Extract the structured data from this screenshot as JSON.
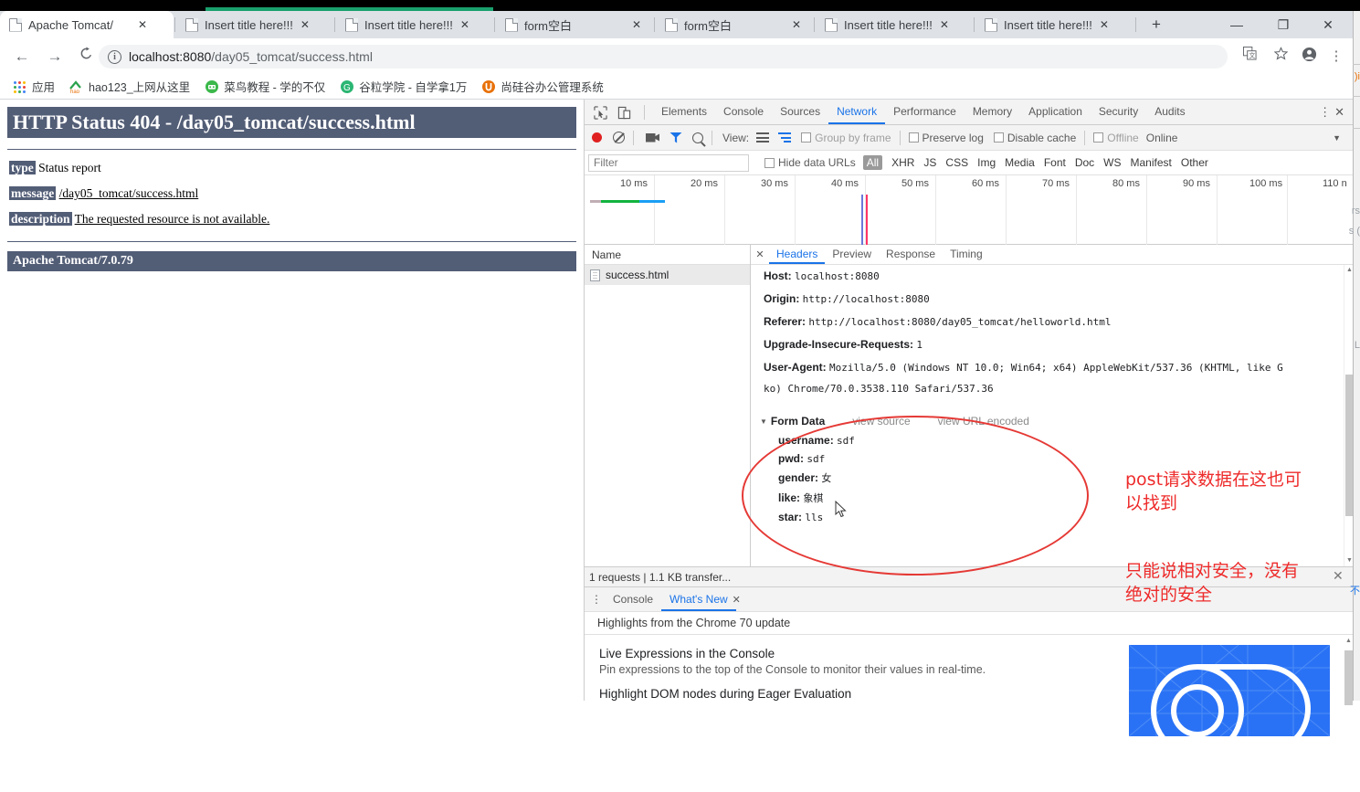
{
  "browser": {
    "tabs": [
      {
        "title": "Apache Tomcat/",
        "active": true
      },
      {
        "title": "Insert title here!!!",
        "active": false
      },
      {
        "title": "Insert title here!!!",
        "active": false
      },
      {
        "title": "form空白",
        "active": false
      },
      {
        "title": "form空白",
        "active": false
      },
      {
        "title": "Insert title here!!!",
        "active": false
      },
      {
        "title": "Insert title here!!!",
        "active": false
      }
    ],
    "new_tab_label": "+",
    "window_minimize": "—",
    "window_restore": "❐",
    "window_close": "✕",
    "nav": {
      "back": "←",
      "forward": "→",
      "reload": "C"
    },
    "url_host": "localhost:8080",
    "url_path": "/day05_tomcat/success.html",
    "omnibox_icons": [
      "translate-icon",
      "star-icon",
      "profile-icon",
      "menu-icon"
    ],
    "bookmarks": [
      {
        "label": "应用",
        "icon": "apps-grid-icon"
      },
      {
        "label": "hao123_上网从这里",
        "icon": "hao123-icon"
      },
      {
        "label": "菜鸟教程 - 学的不仅",
        "icon": "runoob-icon"
      },
      {
        "label": "谷粒学院 - 自学拿1万",
        "icon": "guli-icon"
      },
      {
        "label": "尚硅谷办公管理系统",
        "icon": "atguigu-icon"
      }
    ]
  },
  "tomcat": {
    "title": "HTTP Status 404 - /day05_tomcat/success.html",
    "rows": [
      {
        "key": "type",
        "value": "Status report",
        "link": false
      },
      {
        "key": "message",
        "value": "/day05_tomcat/success.html",
        "link": true
      },
      {
        "key": "description",
        "value": "The requested resource is not available.",
        "link": true
      }
    ],
    "footer": "Apache Tomcat/7.0.79"
  },
  "devtools": {
    "panels": [
      "Elements",
      "Console",
      "Sources",
      "Network",
      "Performance",
      "Memory",
      "Application",
      "Security",
      "Audits"
    ],
    "active_panel": "Network",
    "more_label": "⋮",
    "close_label": "✕",
    "toolbar": {
      "view_label": "View:",
      "group_by_frame": "Group by frame",
      "preserve_log": "Preserve log",
      "disable_cache": "Disable cache",
      "offline": "Offline",
      "online": "Online",
      "caret": "▼"
    },
    "filterbar": {
      "placeholder": "Filter",
      "hide_data_urls": "Hide data URLs",
      "types": [
        "All",
        "XHR",
        "JS",
        "CSS",
        "Img",
        "Media",
        "Font",
        "Doc",
        "WS",
        "Manifest",
        "Other"
      ],
      "active_type": "All"
    },
    "overview_ticks": [
      "10 ms",
      "20 ms",
      "30 ms",
      "40 ms",
      "50 ms",
      "60 ms",
      "70 ms",
      "80 ms",
      "90 ms",
      "100 ms",
      "110 n"
    ],
    "name_column_header": "Name",
    "requests": [
      {
        "name": "success.html",
        "selected": true
      }
    ],
    "detail_tabs": [
      "Headers",
      "Preview",
      "Response",
      "Timing"
    ],
    "active_detail_tab": "Headers",
    "headers": [
      {
        "name": "Host:",
        "value": "localhost:8080"
      },
      {
        "name": "Origin:",
        "value": "http://localhost:8080"
      },
      {
        "name": "Referer:",
        "value": "http://localhost:8080/day05_tomcat/helloworld.html"
      },
      {
        "name": "Upgrade-Insecure-Requests:",
        "value": "1"
      },
      {
        "name": "User-Agent:",
        "value": "Mozilla/5.0 (Windows NT 10.0; Win64; x64) AppleWebKit/537.36 (KHTML, like G"
      },
      {
        "name": "",
        "value": "ko) Chrome/70.0.3538.110 Safari/537.36"
      }
    ],
    "form_data": {
      "title": "Form Data",
      "view_source": "view source",
      "view_url_encoded": "view URL encoded",
      "fields": [
        {
          "key": "username:",
          "value": "sdf"
        },
        {
          "key": "pwd:",
          "value": "sdf"
        },
        {
          "key": "gender:",
          "value": "女"
        },
        {
          "key": "like:",
          "value": "象棋"
        },
        {
          "key": "star:",
          "value": "lls"
        }
      ]
    },
    "status_bar": "1 requests | 1.1 KB transfer...",
    "drawer": {
      "tabs": [
        "Console",
        "What's New"
      ],
      "active_tab": "What's New",
      "close_label": "✕",
      "subtitle": "Highlights from the Chrome 70 update",
      "items": [
        {
          "heading": "Live Expressions in the Console",
          "text": "Pin expressions to the top of the Console to monitor their values in real-time."
        },
        {
          "heading": "Highlight DOM nodes during Eager Evaluation",
          "text": ""
        }
      ]
    },
    "sidebar_toggle": "‹"
  },
  "annotations": [
    {
      "text": "post请求数据在这也可\n以找到",
      "color": "#ee2b2b"
    },
    {
      "text": "只能说相对安全，没有\n绝对的安全",
      "color": "#ee2b2b"
    }
  ]
}
